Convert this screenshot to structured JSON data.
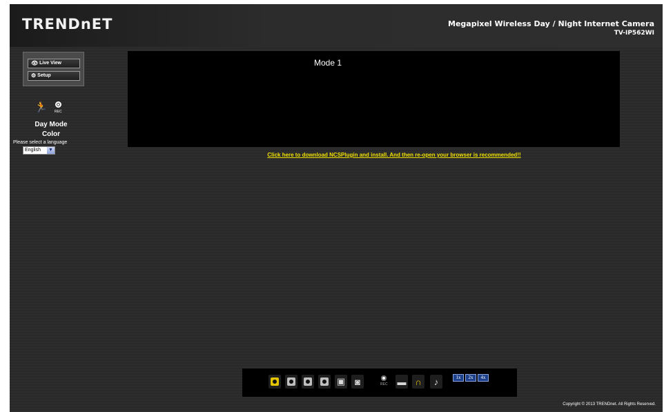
{
  "header": {
    "logo": "TRENDnET",
    "camera_title": "Megapixel Wireless Day / Night Internet Camera",
    "camera_model": "TV-IP562WI"
  },
  "nav": {
    "live_view": "Live View",
    "setup": "Setup"
  },
  "status": {
    "rec_label": "REC",
    "mode": "Day Mode",
    "color": "Color",
    "language_prompt": "Please select a language",
    "language_selected": "English"
  },
  "video": {
    "mode_text": "Mode 1"
  },
  "download_link": "Click here to download NCSPlugin and install. And then re-open your browser is recommended!!",
  "toolbar": {
    "rec_label": "REC",
    "zoom": [
      "1x",
      "2x",
      "4x"
    ]
  },
  "footer": {
    "copyright": "Copyright © 2013 TRENDnet. All Rights Reserved."
  },
  "colors": {
    "accent_yellow": "#e3c400",
    "link_yellow": "#f0e000",
    "video_bg": "#000000",
    "page_bg": "#2d2d2d"
  }
}
